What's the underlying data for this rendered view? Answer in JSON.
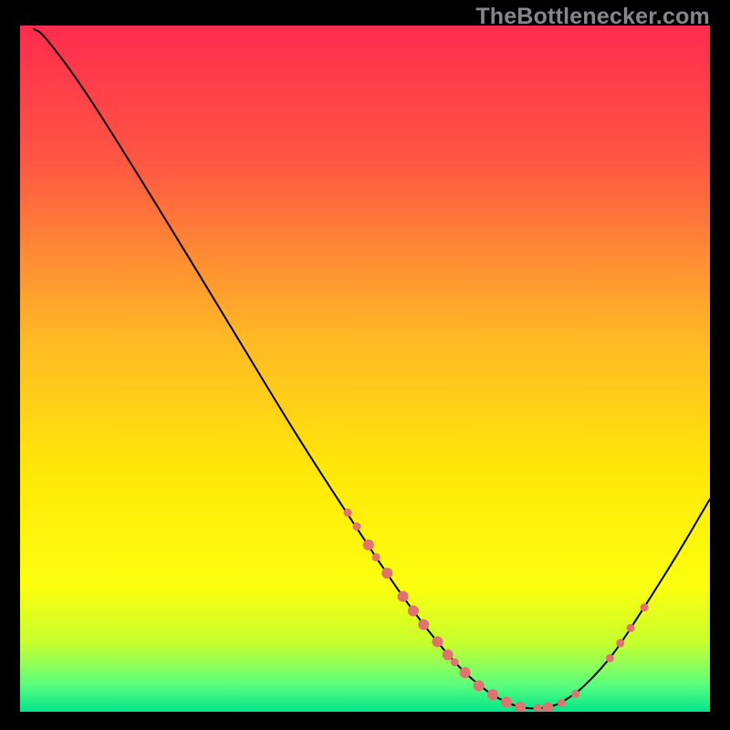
{
  "watermark": "TheBottlenecker.com",
  "chart_data": {
    "type": "line",
    "title": "",
    "xlabel": "",
    "ylabel": "",
    "xlim": [
      0,
      100
    ],
    "ylim": [
      0,
      100
    ],
    "background_gradient": {
      "stops": [
        {
          "offset": 0,
          "color": "#ff2b4e"
        },
        {
          "offset": 0.2,
          "color": "#ff5743"
        },
        {
          "offset": 0.45,
          "color": "#ffb726"
        },
        {
          "offset": 0.65,
          "color": "#ffe808"
        },
        {
          "offset": 0.82,
          "color": "#fbff0e"
        },
        {
          "offset": 0.9,
          "color": "#c6ff2e"
        },
        {
          "offset": 0.96,
          "color": "#5cff7d"
        },
        {
          "offset": 1.0,
          "color": "#00e58a"
        }
      ]
    },
    "curve": {
      "color": "#000000",
      "width": 2,
      "points": [
        {
          "x": 2.0,
          "y": 99.5
        },
        {
          "x": 4.0,
          "y": 97.8
        },
        {
          "x": 10.0,
          "y": 89.5
        },
        {
          "x": 20.0,
          "y": 73.5
        },
        {
          "x": 30.0,
          "y": 57.0
        },
        {
          "x": 40.0,
          "y": 40.5
        },
        {
          "x": 48.0,
          "y": 28.0
        },
        {
          "x": 55.0,
          "y": 17.5
        },
        {
          "x": 60.0,
          "y": 10.8
        },
        {
          "x": 64.0,
          "y": 6.2
        },
        {
          "x": 68.0,
          "y": 2.8
        },
        {
          "x": 71.0,
          "y": 1.2
        },
        {
          "x": 73.0,
          "y": 0.6
        },
        {
          "x": 75.0,
          "y": 0.5
        },
        {
          "x": 77.0,
          "y": 0.8
        },
        {
          "x": 79.0,
          "y": 1.7
        },
        {
          "x": 82.0,
          "y": 4.0
        },
        {
          "x": 86.0,
          "y": 8.5
        },
        {
          "x": 90.0,
          "y": 14.5
        },
        {
          "x": 95.0,
          "y": 22.5
        },
        {
          "x": 100.0,
          "y": 31.0
        }
      ]
    },
    "markers": {
      "color": "#e0736f",
      "radius_small": 4.5,
      "radius_large": 6.0,
      "points": [
        {
          "x": 47.5,
          "y": 29.0,
          "r": "small"
        },
        {
          "x": 48.8,
          "y": 27.0,
          "r": "small"
        },
        {
          "x": 50.5,
          "y": 24.3,
          "r": "large"
        },
        {
          "x": 51.6,
          "y": 22.5,
          "r": "small"
        },
        {
          "x": 53.2,
          "y": 20.2,
          "r": "large"
        },
        {
          "x": 55.5,
          "y": 16.8,
          "r": "large"
        },
        {
          "x": 57.0,
          "y": 14.7,
          "r": "large"
        },
        {
          "x": 58.5,
          "y": 12.7,
          "r": "large"
        },
        {
          "x": 60.5,
          "y": 10.2,
          "r": "large"
        },
        {
          "x": 62.0,
          "y": 8.3,
          "r": "large"
        },
        {
          "x": 63.0,
          "y": 7.2,
          "r": "small"
        },
        {
          "x": 64.5,
          "y": 5.7,
          "r": "large"
        },
        {
          "x": 66.5,
          "y": 3.8,
          "r": "large"
        },
        {
          "x": 68.5,
          "y": 2.5,
          "r": "large"
        },
        {
          "x": 70.5,
          "y": 1.4,
          "r": "large"
        },
        {
          "x": 72.5,
          "y": 0.7,
          "r": "large"
        },
        {
          "x": 75.0,
          "y": 0.5,
          "r": "small"
        },
        {
          "x": 76.5,
          "y": 0.6,
          "r": "large"
        },
        {
          "x": 78.5,
          "y": 1.3,
          "r": "small"
        },
        {
          "x": 80.5,
          "y": 2.6,
          "r": "small"
        },
        {
          "x": 85.5,
          "y": 7.8,
          "r": "small"
        },
        {
          "x": 87.0,
          "y": 10.0,
          "r": "small"
        },
        {
          "x": 88.5,
          "y": 12.2,
          "r": "small"
        },
        {
          "x": 90.5,
          "y": 15.2,
          "r": "small"
        }
      ]
    }
  }
}
